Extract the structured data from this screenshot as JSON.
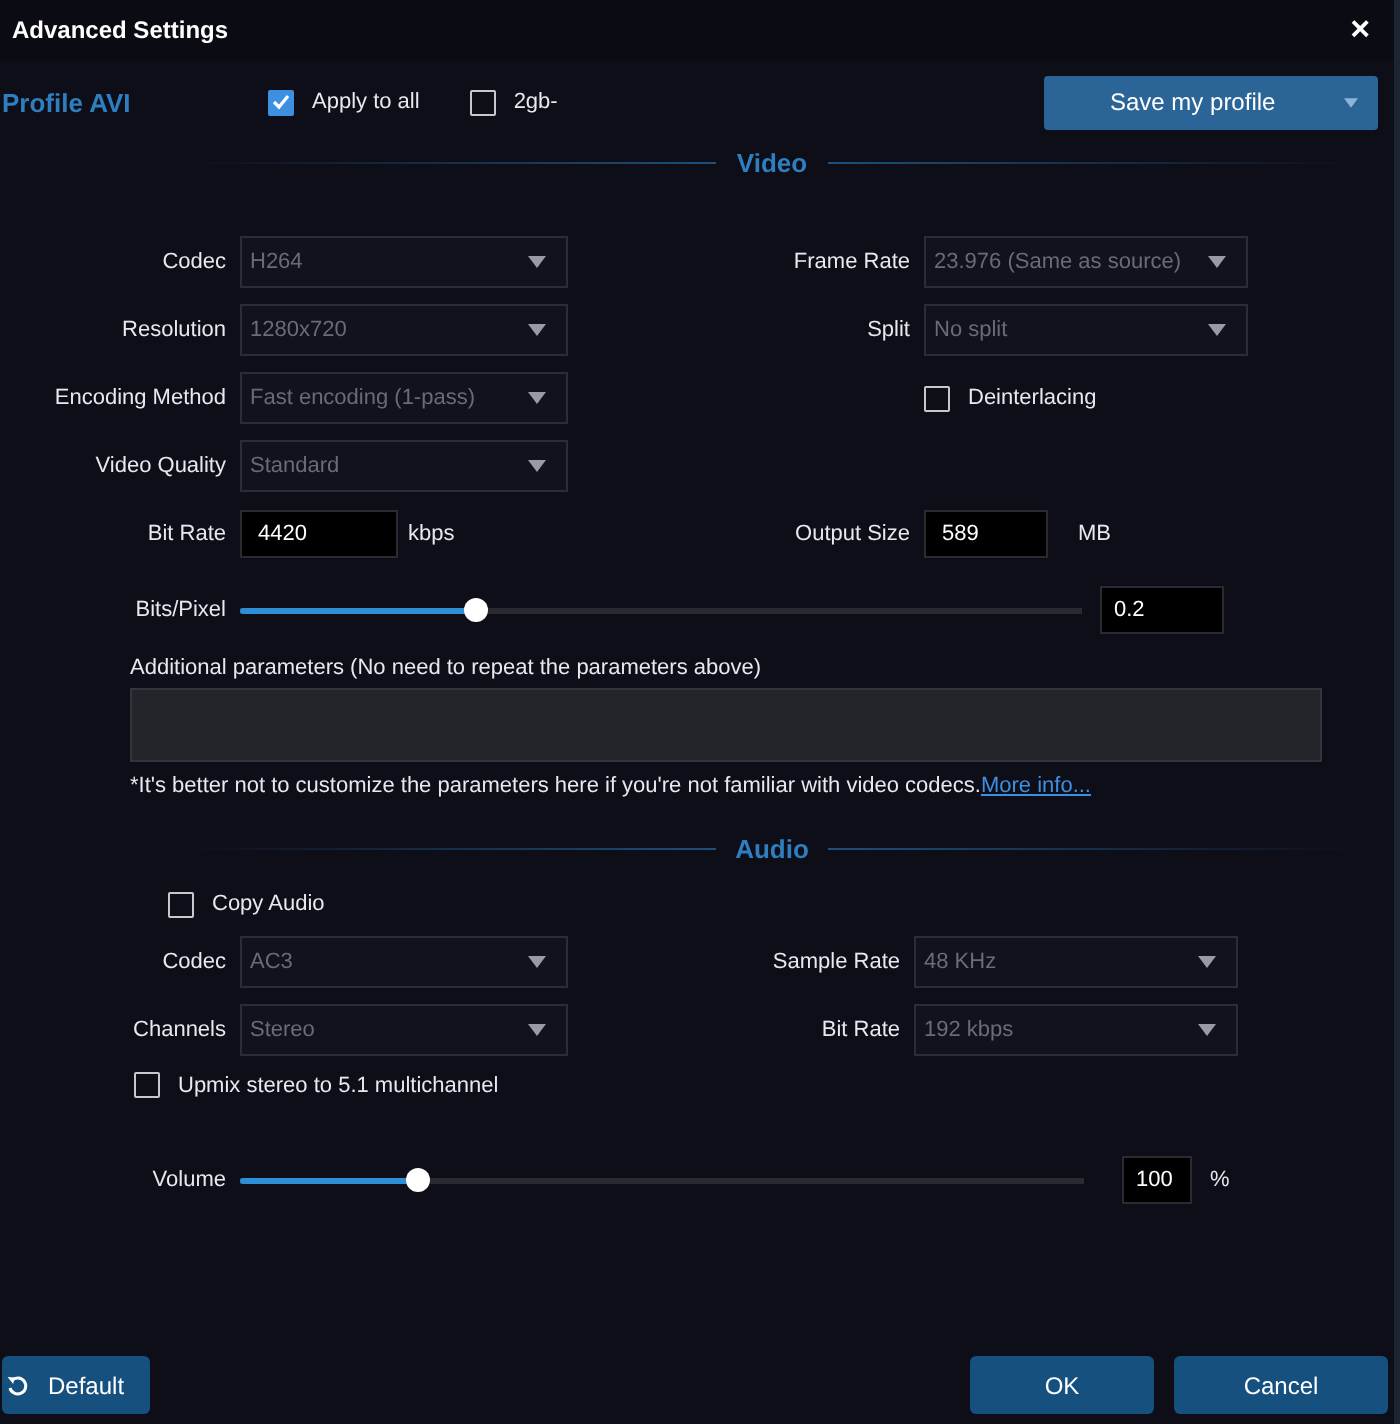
{
  "window": {
    "title": "Advanced Settings",
    "close": "×"
  },
  "profile": {
    "label": "Profile AVI"
  },
  "options": [
    {
      "label": "Apply to all",
      "checked": true
    },
    {
      "label": "2gb-",
      "checked": false
    }
  ],
  "save_button": {
    "label": "Save my profile"
  },
  "video": {
    "heading": "Video",
    "rows": [
      {
        "left": {
          "kind": "select",
          "label": "Codec",
          "value": "H264"
        },
        "right": {
          "kind": "select",
          "label": "Frame Rate",
          "value": "23.976 (Same as source)"
        }
      },
      {
        "left": {
          "kind": "select",
          "label": "Resolution",
          "value": "1280x720"
        },
        "right": {
          "kind": "select",
          "label": "Split",
          "value": "No split"
        }
      },
      {
        "left": {
          "kind": "select",
          "label": "Encoding Method",
          "value": "Fast encoding (1-pass)"
        },
        "right": {
          "kind": "checkbox",
          "label": "Deinterlacing",
          "checked": false
        }
      },
      {
        "left": {
          "kind": "select",
          "label": "Video Quality",
          "value": "Standard"
        }
      },
      {
        "left": {
          "kind": "input",
          "label": "Bit Rate",
          "value": "4420",
          "unit": "kbps"
        },
        "right": {
          "kind": "input",
          "label": "Output Size",
          "value": "589",
          "unit": "MB"
        }
      }
    ],
    "slider": {
      "label": "Bits/Pixel",
      "level": 0.28,
      "value": "0.2"
    },
    "additional": {
      "label": "Additional parameters (No need to repeat the parameters above)"
    },
    "note": {
      "text": "*It's better not to customize the parameters here if you're not familiar with video codecs.",
      "link": "More info..."
    }
  },
  "audio": {
    "heading": "Audio",
    "copy": {
      "label": "Copy Audio",
      "checked": false
    },
    "rows": [
      {
        "left": {
          "kind": "select",
          "label": "Codec",
          "value": "AC3"
        },
        "right": {
          "kind": "select",
          "label": "Sample Rate",
          "value": "48 KHz"
        }
      },
      {
        "left": {
          "kind": "select",
          "label": "Channels",
          "value": "Stereo"
        },
        "right": {
          "kind": "select",
          "label": "Bit Rate",
          "value": "192 kbps"
        }
      }
    ],
    "upmix": {
      "label": "Upmix stereo to 5.1 multichannel",
      "checked": false
    },
    "slider": {
      "label": "Volume",
      "level": 0.21,
      "value": "100",
      "unit": "%"
    }
  },
  "footer": {
    "default": "Default",
    "ok": "OK",
    "cancel": "Cancel"
  }
}
